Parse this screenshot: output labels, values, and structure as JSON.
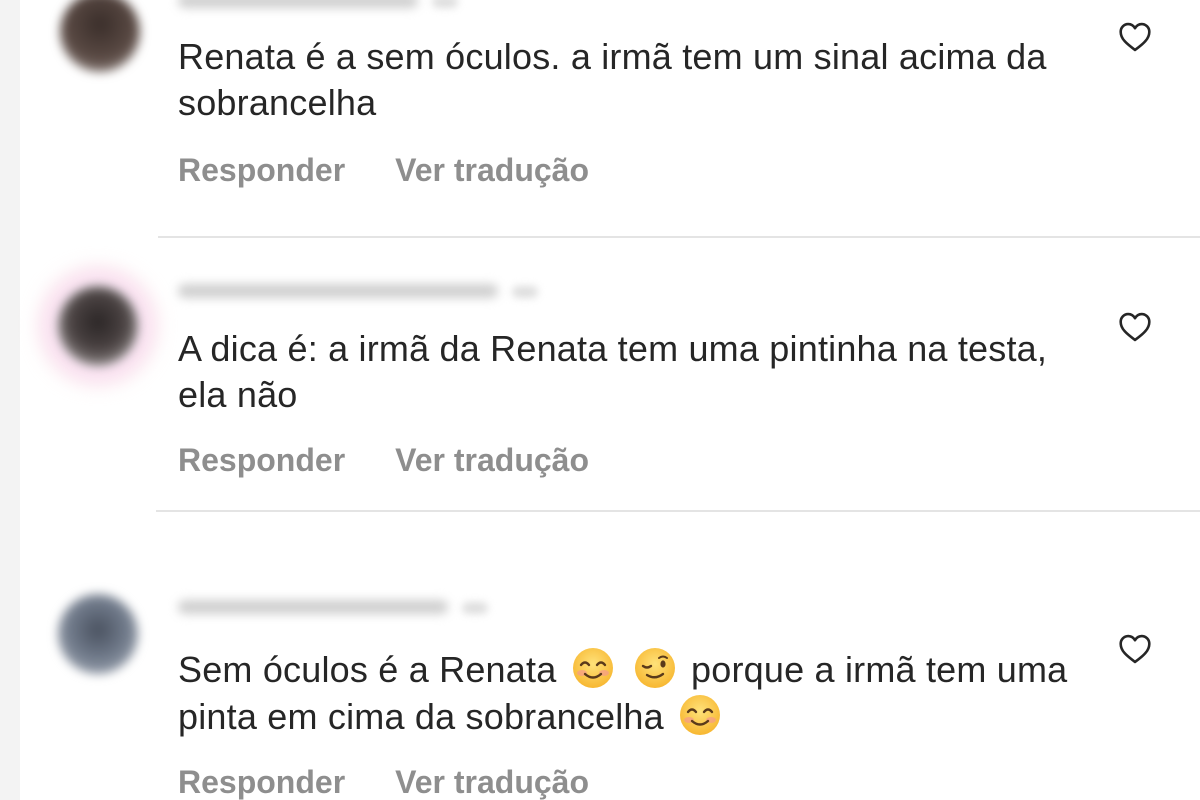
{
  "comments": [
    {
      "text": "Renata é a sem óculos. a irmã tem um sinal acima da sobrancelha",
      "reply_label": "Responder",
      "translate_label": "Ver tradução"
    },
    {
      "text": "A dica é: a irmã da Renata tem uma pintinha na testa, ela não",
      "reply_label": "Responder",
      "translate_label": "Ver tradução"
    },
    {
      "text_part1": "Sem óculos é a Renata",
      "emoji1": "smiling-face-with-smiling-eyes",
      "emoji2": "winking-face",
      "text_part2": "porque a irmã tem uma pinta em cima da sobrancelha",
      "emoji3": "smiling-face-with-smiling-eyes",
      "reply_label": "Responder",
      "translate_label": "Ver tradução"
    }
  ],
  "icons": {
    "like": "heart-outline-icon"
  },
  "colors": {
    "text": "#262626",
    "secondary_text": "#8e8e8e",
    "divider": "#e4e4e4"
  }
}
